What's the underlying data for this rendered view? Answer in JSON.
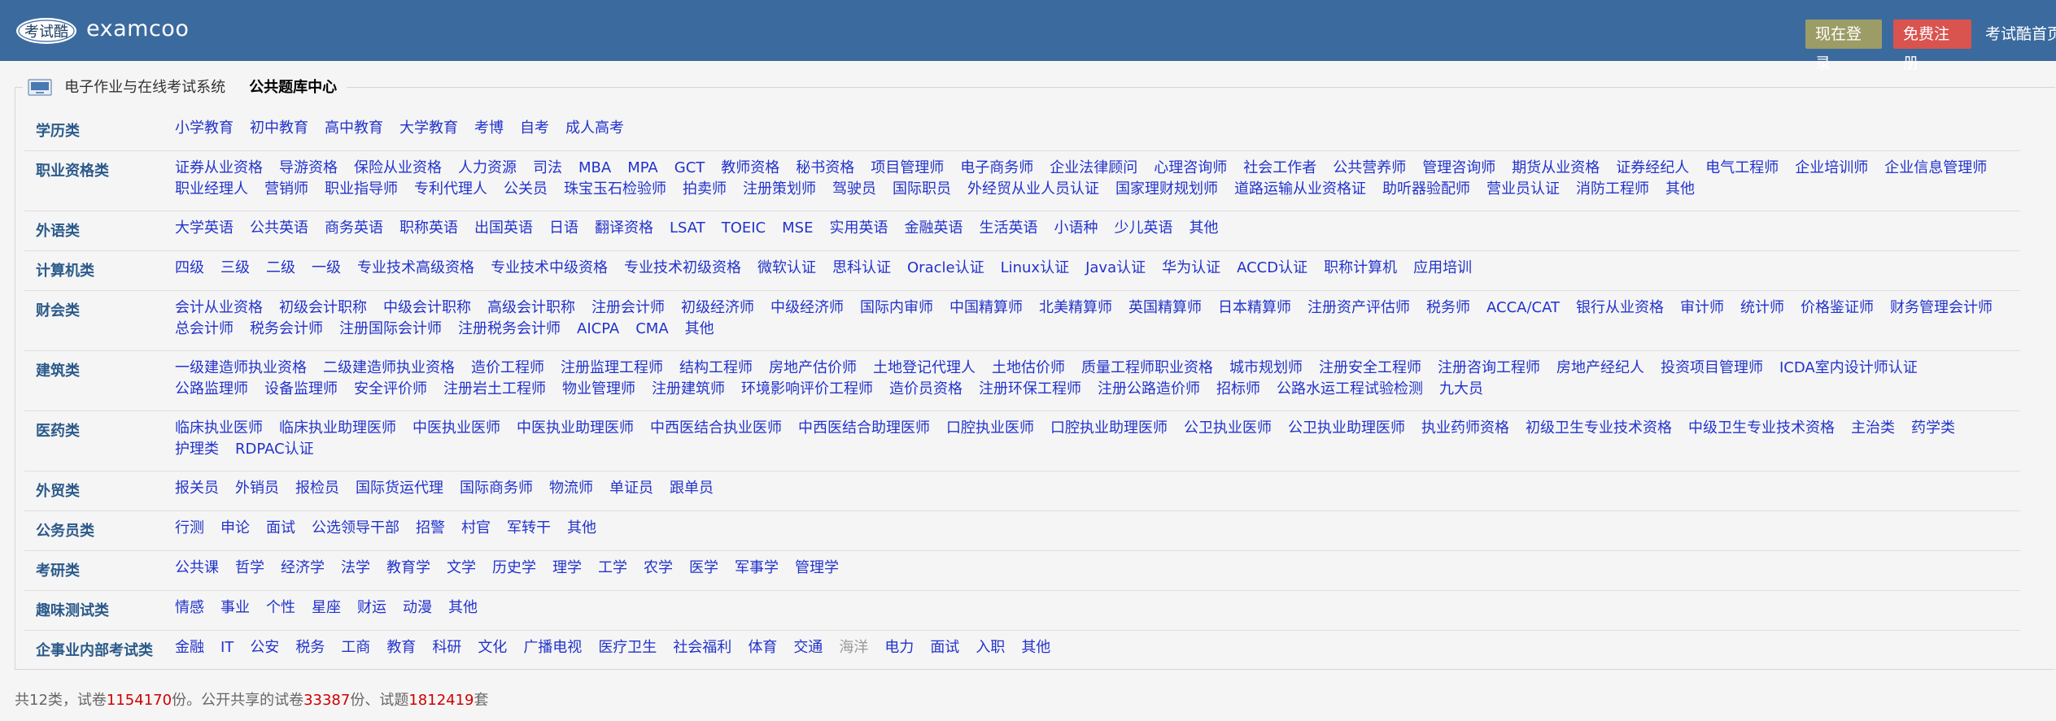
{
  "header": {
    "logo_text": "考试酷",
    "brand": "examcoo",
    "login_label": "现在登录",
    "register_label": "免费注册",
    "home_label": "考试酷首页"
  },
  "breadcrumb": {
    "system_link": "电子作业与在线考试系统",
    "current": "公共题库中心"
  },
  "categories": [
    {
      "name": "学历类",
      "items": [
        "小学教育",
        "初中教育",
        "高中教育",
        "大学教育",
        "考博",
        "自考",
        "成人高考"
      ]
    },
    {
      "name": "职业资格类",
      "items": [
        "证券从业资格",
        "导游资格",
        "保险从业资格",
        "人力资源",
        "司法",
        "MBA",
        "MPA",
        "GCT",
        "教师资格",
        "秘书资格",
        "项目管理师",
        "电子商务师",
        "企业法律顾问",
        "心理咨询师",
        "社会工作者",
        "公共营养师",
        "管理咨询师",
        "期货从业资格",
        "证券经纪人",
        "电气工程师",
        "企业培训师",
        "企业信息管理师",
        "职业经理人",
        "营销师",
        "职业指导师",
        "专利代理人",
        "公关员",
        "珠宝玉石检验师",
        "拍卖师",
        "注册策划师",
        "驾驶员",
        "国际职员",
        "外经贸从业人员认证",
        "国家理财规划师",
        "道路运输从业资格证",
        "助听器验配师",
        "营业员认证",
        "消防工程师",
        "其他"
      ]
    },
    {
      "name": "外语类",
      "items": [
        "大学英语",
        "公共英语",
        "商务英语",
        "职称英语",
        "出国英语",
        "日语",
        "翻译资格",
        "LSAT",
        "TOEIC",
        "MSE",
        "实用英语",
        "金融英语",
        "生活英语",
        "小语种",
        "少儿英语",
        "其他"
      ]
    },
    {
      "name": "计算机类",
      "items": [
        "四级",
        "三级",
        "二级",
        "一级",
        "专业技术高级资格",
        "专业技术中级资格",
        "专业技术初级资格",
        "微软认证",
        "思科认证",
        "Oracle认证",
        "Linux认证",
        "Java认证",
        "华为认证",
        "ACCD认证",
        "职称计算机",
        "应用培训"
      ]
    },
    {
      "name": "财会类",
      "items": [
        "会计从业资格",
        "初级会计职称",
        "中级会计职称",
        "高级会计职称",
        "注册会计师",
        "初级经济师",
        "中级经济师",
        "国际内审师",
        "中国精算师",
        "北美精算师",
        "英国精算师",
        "日本精算师",
        "注册资产评估师",
        "税务师",
        "ACCA/CAT",
        "银行从业资格",
        "审计师",
        "统计师",
        "价格鉴证师",
        "财务管理会计师",
        "总会计师",
        "税务会计师",
        "注册国际会计师",
        "注册税务会计师",
        "AICPA",
        "CMA",
        "其他"
      ]
    },
    {
      "name": "建筑类",
      "items": [
        "一级建造师执业资格",
        "二级建造师执业资格",
        "造价工程师",
        "注册监理工程师",
        "结构工程师",
        "房地产估价师",
        "土地登记代理人",
        "土地估价师",
        "质量工程师职业资格",
        "城市规划师",
        "注册安全工程师",
        "注册咨询工程师",
        "房地产经纪人",
        "投资项目管理师",
        "ICDA室内设计师认证",
        "公路监理师",
        "设备监理师",
        "安全评价师",
        "注册岩土工程师",
        "物业管理师",
        "注册建筑师",
        "环境影响评价工程师",
        "造价员资格",
        "注册环保工程师",
        "注册公路造价师",
        "招标师",
        "公路水运工程试验检测",
        "九大员"
      ]
    },
    {
      "name": "医药类",
      "items": [
        "临床执业医师",
        "临床执业助理医师",
        "中医执业医师",
        "中医执业助理医师",
        "中西医结合执业医师",
        "中西医结合助理医师",
        "口腔执业医师",
        "口腔执业助理医师",
        "公卫执业医师",
        "公卫执业助理医师",
        "执业药师资格",
        "初级卫生专业技术资格",
        "中级卫生专业技术资格",
        "主治类",
        "药学类",
        "护理类",
        "RDPAC认证"
      ]
    },
    {
      "name": "外贸类",
      "items": [
        "报关员",
        "外销员",
        "报检员",
        "国际货运代理",
        "国际商务师",
        "物流师",
        "单证员",
        "跟单员"
      ]
    },
    {
      "name": "公务员类",
      "items": [
        "行测",
        "申论",
        "面试",
        "公选领导干部",
        "招警",
        "村官",
        "军转干",
        "其他"
      ]
    },
    {
      "name": "考研类",
      "items": [
        "公共课",
        "哲学",
        "经济学",
        "法学",
        "教育学",
        "文学",
        "历史学",
        "理学",
        "工学",
        "农学",
        "医学",
        "军事学",
        "管理学"
      ]
    },
    {
      "name": "趣味测试类",
      "items": [
        "情感",
        "事业",
        "个性",
        "星座",
        "财运",
        "动漫",
        "其他"
      ]
    },
    {
      "name": "企事业内部考试类",
      "items": [
        "金融",
        "IT",
        "公安",
        "税务",
        "工商",
        "教育",
        "科研",
        "文化",
        "广播电视",
        "医疗卫生",
        "社会福利",
        "体育",
        "交通",
        "海洋",
        "电力",
        "面试",
        "入职",
        "其他"
      ]
    }
  ],
  "disabled_items": [
    "海洋"
  ],
  "footer": {
    "prefix": "共12类，试卷",
    "papers": "1154170",
    "mid1": "份。公开共享的试卷",
    "shared": "33387",
    "mid2": "份、试题",
    "questions": "1812419",
    "suffix": "套"
  },
  "colors": {
    "header_bg": "#3b6a9e",
    "login_bg": "#9c9c66",
    "register_bg": "#d9534f",
    "category_name": "#2b5a8a",
    "link": "#2233cc",
    "footer_number": "#d00000"
  }
}
